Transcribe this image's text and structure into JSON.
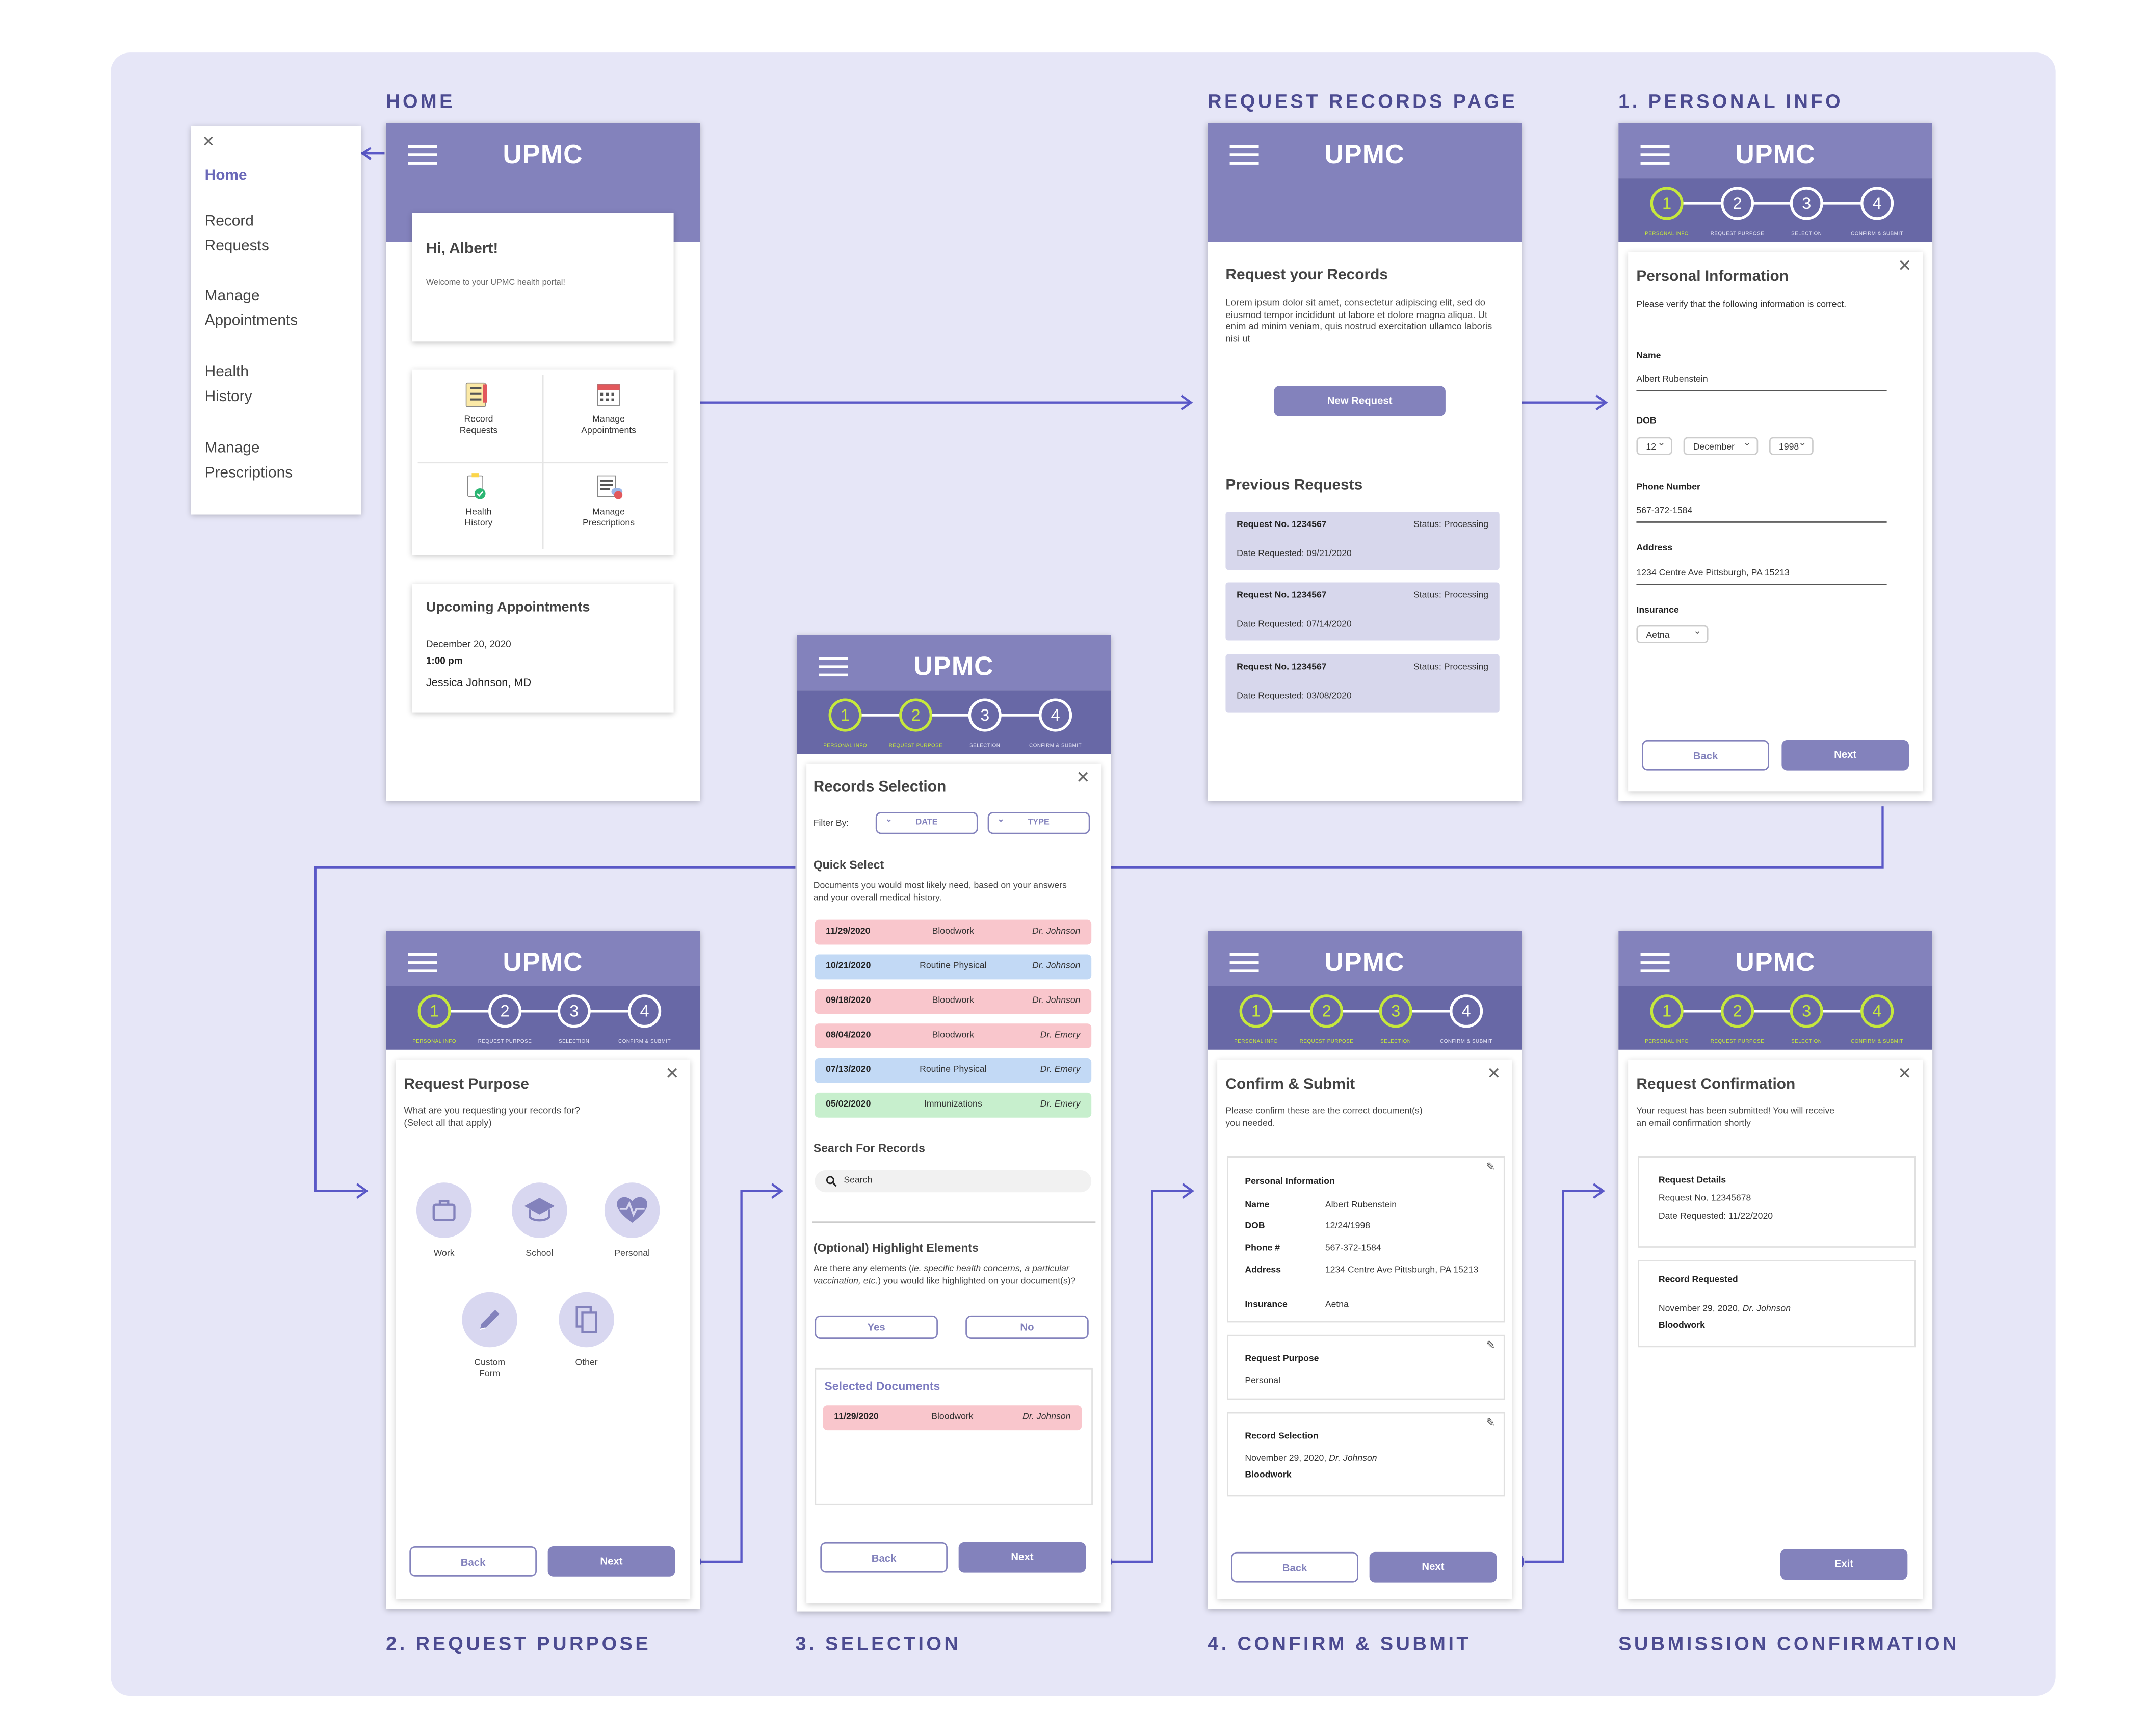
{
  "colors": {
    "accent": "#8382bc",
    "accent_dark": "#6868a6",
    "step_done": "#c6e83c",
    "canvas": "#e6e6f7",
    "flow_line": "#5a58c7"
  },
  "titles": {
    "home": "HOME",
    "request_records": "REQUEST RECORDS PAGE",
    "personal_info": "1. PERSONAL INFO",
    "request_purpose": "2. REQUEST PURPOSE",
    "selection": "3. SELECTION",
    "confirm": "4. CONFIRM & SUBMIT",
    "submission": "SUBMISSION CONFIRMATION"
  },
  "app": {
    "logo": "UPMC"
  },
  "steps": {
    "labels": [
      "PERSONAL INFO",
      "REQUEST PURPOSE",
      "SELECTION",
      "CONFIRM & SUBMIT"
    ],
    "numbers": [
      "1",
      "2",
      "3",
      "4"
    ]
  },
  "buttons": {
    "back": "Back",
    "next": "Next",
    "exit": "Exit",
    "new_request": "New Request",
    "yes": "Yes",
    "no": "No"
  },
  "menu": {
    "items": [
      "Home",
      "Record\nRequests",
      "Manage\nAppointments",
      "Health\nHistory",
      "Manage\nPrescriptions"
    ]
  },
  "home": {
    "greeting": "Hi, Albert!",
    "welcome": "Welcome to your UPMC health portal!",
    "tiles": [
      "Record\nRequests",
      "Manage\nAppointments",
      "Health\nHistory",
      "Manage\nPrescriptions"
    ],
    "upcoming_title": "Upcoming Appointments",
    "appt_date": "December 20, 2020",
    "appt_time": "1:00 pm",
    "appt_doctor": "Jessica Johnson, MD"
  },
  "request_page": {
    "title": "Request your Records",
    "body": "Lorem ipsum dolor sit amet, consectetur adipiscing elit, sed do eiusmod tempor incididunt ut labore et dolore magna aliqua. Ut enim ad minim veniam, quis nostrud exercitation ullamco laboris nisi ut",
    "previous_title": "Previous Requests",
    "requests": [
      {
        "no": "Request No. 1234567",
        "status": "Status: Processing",
        "date": "Date Requested: 09/21/2020"
      },
      {
        "no": "Request No. 1234567",
        "status": "Status: Processing",
        "date": "Date Requested: 07/14/2020"
      },
      {
        "no": "Request No. 1234567",
        "status": "Status: Processing",
        "date": "Date Requested: 03/08/2020"
      }
    ]
  },
  "personal": {
    "title": "Personal Information",
    "subtitle": "Please verify that the following information is correct.",
    "name_label": "Name",
    "name": "Albert Rubenstein",
    "dob_label": "DOB",
    "dob_day": "12",
    "dob_month": "December",
    "dob_year": "1998",
    "phone_label": "Phone Number",
    "phone": "567-372-1584",
    "address_label": "Address",
    "address": "1234 Centre Ave Pittsburgh, PA 15213",
    "insurance_label": "Insurance",
    "insurance": "Aetna"
  },
  "purpose": {
    "title": "Request Purpose",
    "question": "What are you requesting your records for?\n(Select all that apply)",
    "options": [
      "Work",
      "School",
      "Personal",
      "Custom\nForm",
      "Other"
    ]
  },
  "selection": {
    "title": "Records Selection",
    "filter_by": "Filter By:",
    "filter_date": "DATE",
    "filter_type": "TYPE",
    "quick_title": "Quick Select",
    "quick_desc": "Documents you would most likely need, based on your answers and your overall medical history.",
    "records": [
      {
        "date": "11/29/2020",
        "type": "Bloodwork",
        "doctor": "Dr. Johnson",
        "color": "#f9c6cc"
      },
      {
        "date": "10/21/2020",
        "type": "Routine Physical",
        "doctor": "Dr. Johnson",
        "color": "#c2d9f5"
      },
      {
        "date": "09/18/2020",
        "type": "Bloodwork",
        "doctor": "Dr. Johnson",
        "color": "#f9c6cc"
      },
      {
        "date": "08/04/2020",
        "type": "Bloodwork",
        "doctor": "Dr. Emery",
        "color": "#f9c6cc"
      },
      {
        "date": "07/13/2020",
        "type": "Routine Physical",
        "doctor": "Dr. Emery",
        "color": "#c2d9f5"
      },
      {
        "date": "05/02/2020",
        "type": "Immunizations",
        "doctor": "Dr. Emery",
        "color": "#c7efcd"
      }
    ],
    "search_title": "Search For Records",
    "search_placeholder": "Search",
    "highlight_title": "(Optional) Highlight Elements",
    "highlight_q1": "Are there any elements (",
    "highlight_q_ie": "ie. specific health concerns, a particular vaccination, etc.",
    "highlight_q2": ") you would like highlighted on your document(s)?",
    "selected_title": "Selected Documents",
    "selected": {
      "date": "11/29/2020",
      "type": "Bloodwork",
      "doctor": "Dr. Johnson"
    }
  },
  "confirm": {
    "title": "Confirm & Submit",
    "subtitle": "Please confirm these are the correct document(s) you needed.",
    "pi_title": "Personal Information",
    "rows": [
      {
        "k": "Name",
        "v": "Albert Rubenstein"
      },
      {
        "k": "DOB",
        "v": "12/24/1998"
      },
      {
        "k": "Phone #",
        "v": "567-372-1584"
      },
      {
        "k": "Address",
        "v": "1234 Centre Ave Pittsburgh, PA 15213"
      },
      {
        "k": "Insurance",
        "v": "Aetna"
      }
    ],
    "purpose_title": "Request Purpose",
    "purpose_value": "Personal",
    "selection_title": "Record Selection",
    "selection_date": "November 29, 2020, ",
    "selection_doctor": "Dr. Johnson",
    "selection_type": "Bloodwork"
  },
  "submission": {
    "title": "Request Confirmation",
    "subtitle": "Your request has been submitted! You will receive an email confirmation shortly",
    "details_title": "Request Details",
    "request_no": "Request No. 12345678",
    "date_requested": "Date Requested: 11/22/2020",
    "record_title": "Record Requested",
    "record_date": "November 29, 2020, ",
    "record_doctor": "Dr. Johnson",
    "record_type": "Bloodwork"
  }
}
